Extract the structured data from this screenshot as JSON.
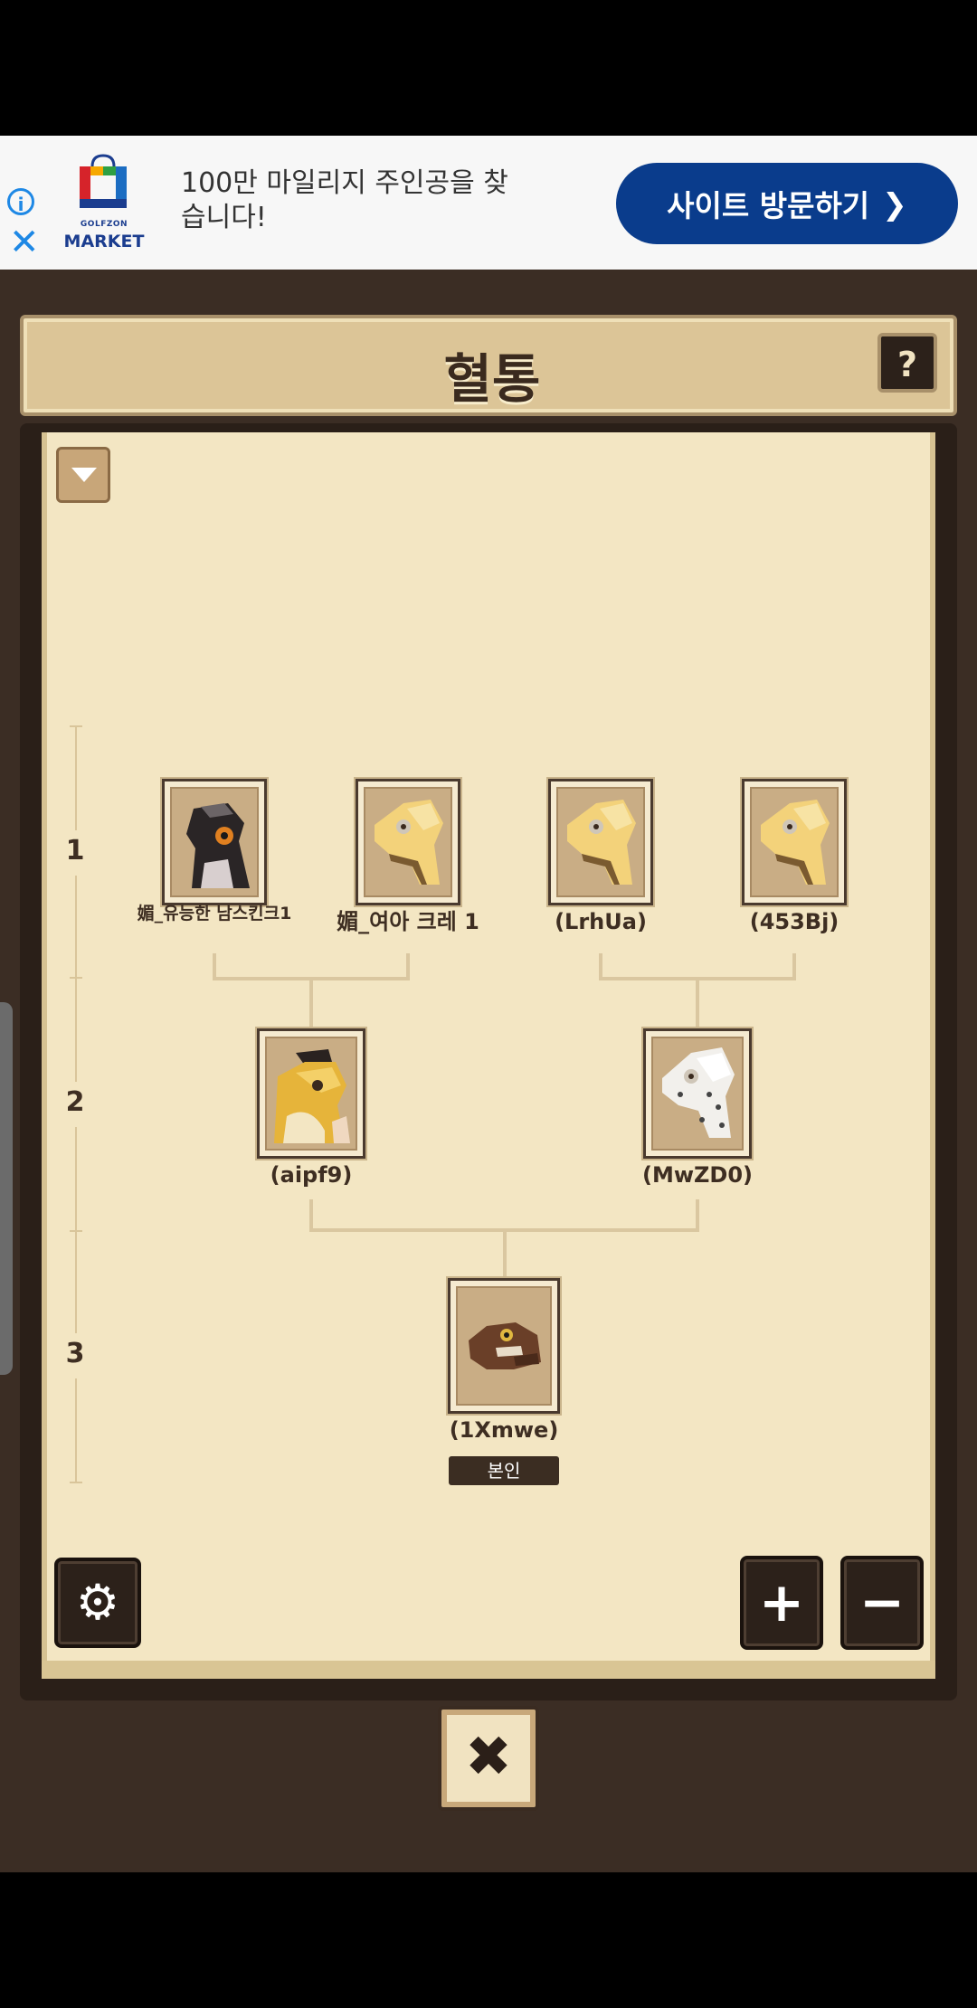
{
  "ad": {
    "info_label": "i",
    "close_label": "✕",
    "logo_sub": "GOLFZON",
    "logo_main": "MARKET",
    "text": "100만 마일리지 주인공을 찾습니다!",
    "cta": "사이트 방문하기",
    "cta_arrow": "❯"
  },
  "header": {
    "title": "혈통",
    "help_label": "?"
  },
  "generations": [
    "1",
    "2",
    "3"
  ],
  "tree": {
    "gen1": [
      {
        "name": "媚_유능한 남스킨크1",
        "creature": "dark-gecko-icon"
      },
      {
        "name": "媚_여아 크레 1",
        "creature": "yellow-gecko-icon"
      },
      {
        "name": "(LrhUa)",
        "creature": "yellow-gecko-icon"
      },
      {
        "name": "(453Bj)",
        "creature": "yellow-gecko-icon"
      }
    ],
    "gen2": [
      {
        "name": "(aipf9)",
        "creature": "golden-gecko-icon"
      },
      {
        "name": "(MwZD0)",
        "creature": "white-gecko-icon"
      }
    ],
    "gen3": [
      {
        "name": "(1Xmwe)",
        "creature": "brown-gecko-icon"
      }
    ],
    "self_badge": "본인"
  },
  "controls": {
    "settings_icon": "⚙",
    "zoom_in": "+",
    "zoom_out": "−",
    "close": "✖"
  },
  "colors": {
    "panel": "#f3e6c3",
    "frame": "#2a1f18",
    "ad_cta": "#0a3c8c"
  }
}
